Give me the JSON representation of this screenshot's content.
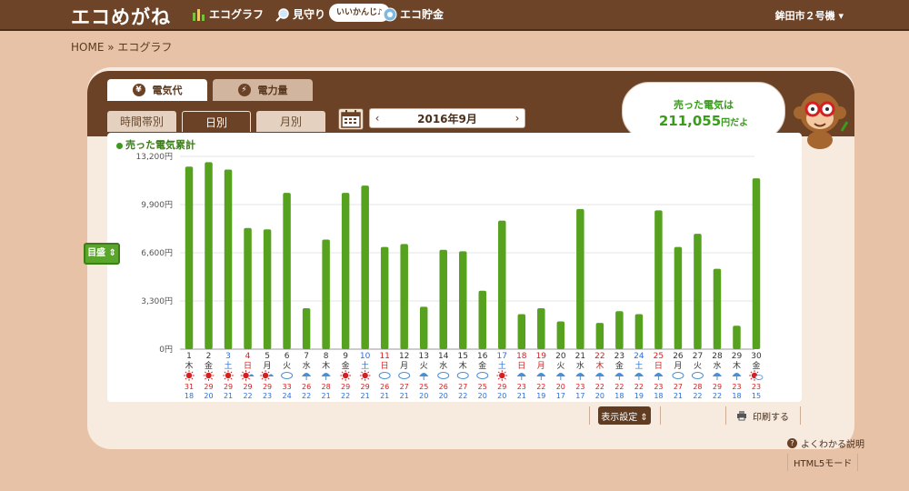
{
  "app": {
    "logo": "エコめがね",
    "nav": [
      {
        "label": "エコグラフ",
        "icon": "bar-chart-icon"
      },
      {
        "label": "見守り",
        "icon": "magnifier-icon"
      },
      {
        "label": "エコ貯金",
        "icon": "coin-icon"
      }
    ],
    "speech": "いいかんじ♪",
    "device": "鉾田市２号機"
  },
  "breadcrumb": "HOME » エコグラフ",
  "tabs": {
    "main": [
      {
        "label": "電気代",
        "icon": "yen-icon",
        "active": true
      },
      {
        "label": "電力量",
        "icon": "lightning-icon",
        "active": false
      }
    ],
    "sub": [
      {
        "label": "時間帯別",
        "active": false
      },
      {
        "label": "日別",
        "active": true
      },
      {
        "label": "月別",
        "active": false
      }
    ]
  },
  "month_nav": {
    "prev": "‹",
    "next": "›",
    "label": "2016年9月"
  },
  "sold_bubble": {
    "line1": "売った電気は",
    "amount": "211,055",
    "unit": "円だよ"
  },
  "legend": "売った電気累計",
  "metric_selector": "目盛 ⇕",
  "chart_data": {
    "type": "bar",
    "color": "#56a21f",
    "ylim": [
      0,
      13200
    ],
    "yticks": [
      "0円",
      "3,300円",
      "6,600円",
      "9,900円",
      "13,200円"
    ],
    "ytick_values": [
      0,
      3300,
      6600,
      9900,
      13200
    ],
    "categories": [
      "1",
      "2",
      "3",
      "4",
      "5",
      "6",
      "7",
      "8",
      "9",
      "10",
      "11",
      "12",
      "13",
      "14",
      "15",
      "16",
      "17",
      "18",
      "19",
      "20",
      "21",
      "22",
      "23",
      "24",
      "25",
      "26",
      "27",
      "28",
      "29",
      "30"
    ],
    "weekdays": [
      "木",
      "金",
      "土",
      "日",
      "月",
      "火",
      "水",
      "木",
      "金",
      "土",
      "日",
      "月",
      "火",
      "水",
      "木",
      "金",
      "土",
      "日",
      "月",
      "火",
      "水",
      "木",
      "金",
      "土",
      "日",
      "月",
      "火",
      "水",
      "木",
      "金"
    ],
    "day_colors": [
      "#333333",
      "#333333",
      "#2a6fd6",
      "#d42020",
      "#333333",
      "#333333",
      "#333333",
      "#333333",
      "#333333",
      "#2a6fd6",
      "#d42020",
      "#333333",
      "#333333",
      "#333333",
      "#333333",
      "#333333",
      "#2a6fd6",
      "#d42020",
      "#d42020",
      "#333333",
      "#333333",
      "#d42020",
      "#333333",
      "#2a6fd6",
      "#d42020",
      "#333333",
      "#333333",
      "#333333",
      "#333333",
      "#333333"
    ],
    "values": [
      12500,
      12800,
      12300,
      8300,
      8200,
      10700,
      2800,
      7500,
      10700,
      11200,
      7000,
      7200,
      2900,
      6800,
      6700,
      4000,
      8800,
      2400,
      2800,
      1900,
      9600,
      1800,
      2600,
      2400,
      9500,
      7000,
      7900,
      5500,
      1600,
      11700
    ],
    "weather": [
      "sun",
      "sun",
      "sun",
      "sun-rain",
      "sun-rain",
      "cloud",
      "umbrella",
      "umbrella",
      "sun",
      "sun",
      "cloud",
      "cloud",
      "umbrella",
      "cloud",
      "cloud",
      "cloud",
      "sun",
      "umbrella",
      "umbrella",
      "umbrella",
      "umbrella",
      "umbrella",
      "umbrella",
      "umbrella",
      "umbrella",
      "cloud",
      "cloud",
      "umbrella",
      "umbrella",
      "sun-cloud"
    ],
    "temp_high": [
      "31",
      "29",
      "29",
      "29",
      "29",
      "33",
      "26",
      "28",
      "29",
      "29",
      "26",
      "27",
      "25",
      "26",
      "27",
      "25",
      "29",
      "23",
      "22",
      "20",
      "23",
      "22",
      "22",
      "22",
      "23",
      "27",
      "28",
      "29",
      "23",
      "23"
    ],
    "temp_low": [
      "18",
      "20",
      "21",
      "22",
      "23",
      "24",
      "22",
      "21",
      "22",
      "21",
      "21",
      "21",
      "20",
      "20",
      "22",
      "20",
      "20",
      "21",
      "19",
      "17",
      "17",
      "20",
      "18",
      "19",
      "18",
      "21",
      "22",
      "22",
      "18",
      "15"
    ]
  },
  "footer": {
    "display_settings": "表示設定 ⇕",
    "print": "印刷する",
    "faq": "よくわかる説明",
    "html5": "HTML5モード"
  }
}
